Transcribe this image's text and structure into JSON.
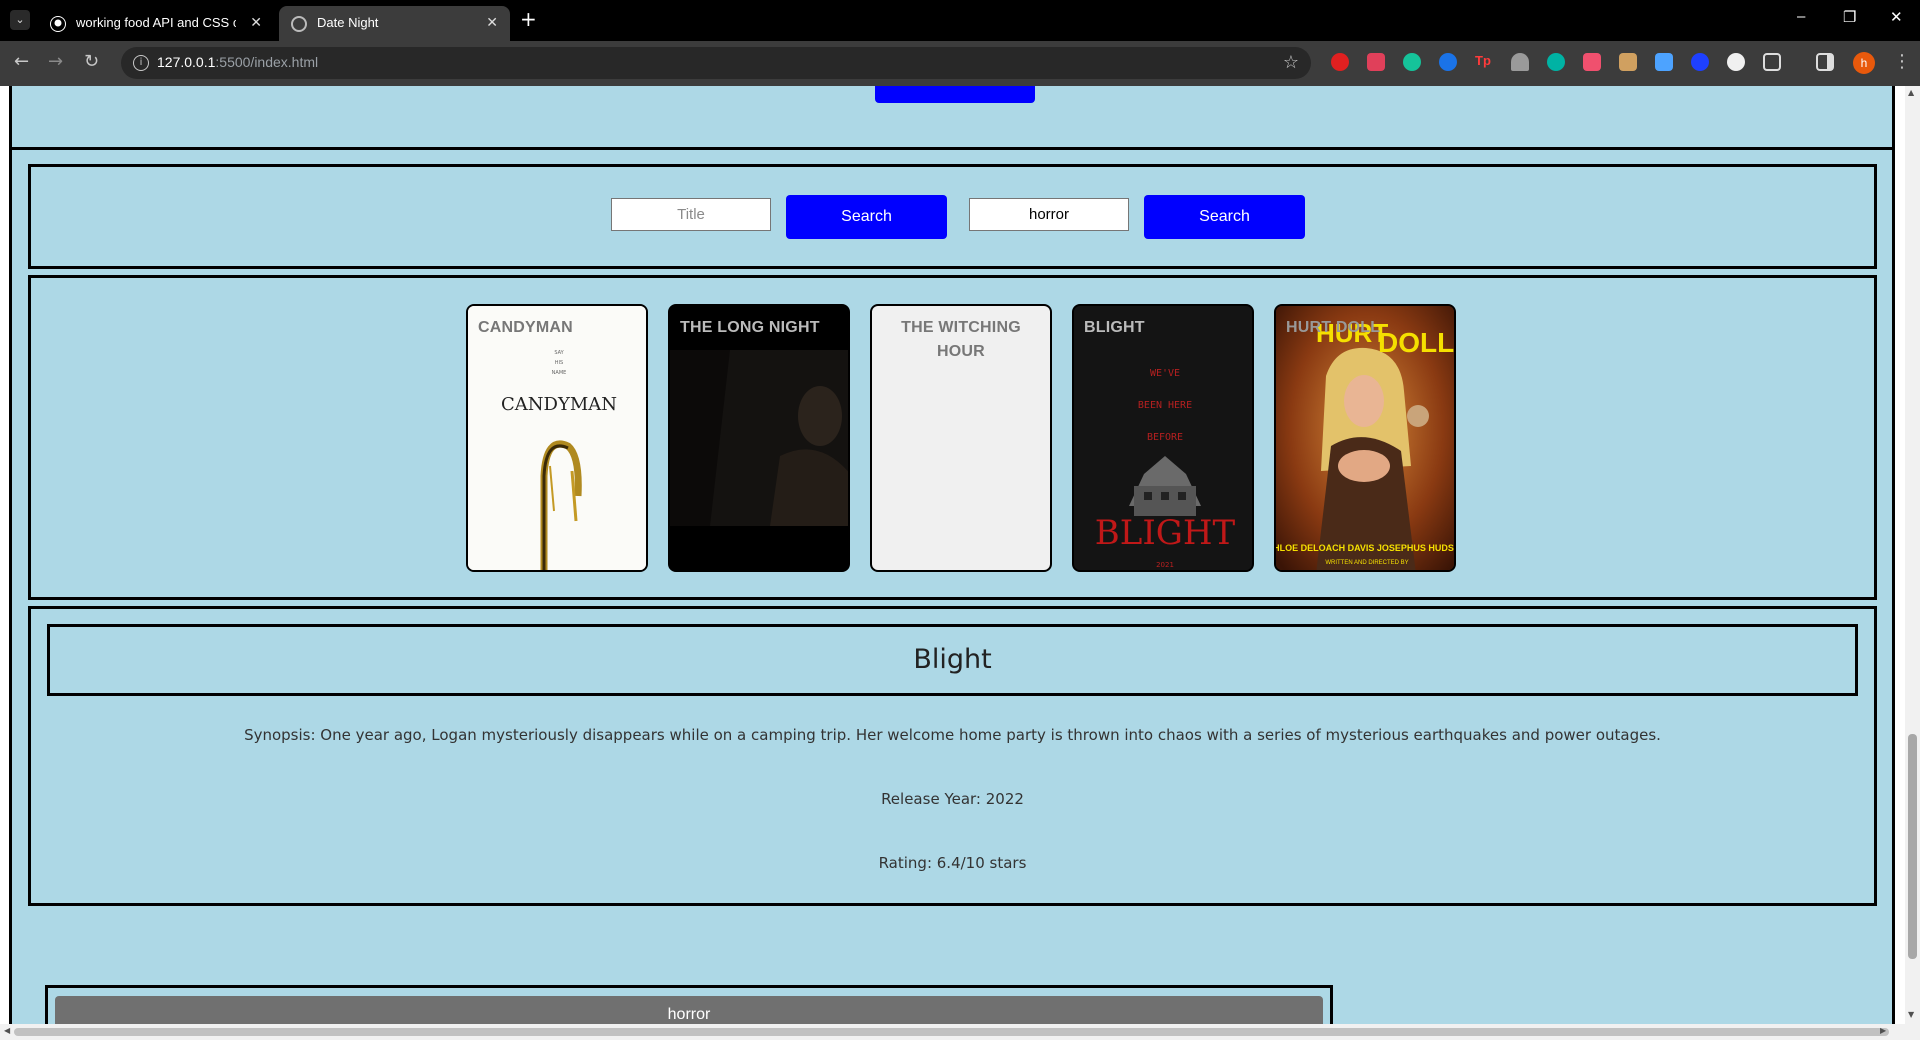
{
  "browser": {
    "tabs": [
      {
        "title": "working food API and CSS corr",
        "active": false,
        "icon": "github-icon"
      },
      {
        "title": "Date Night",
        "active": true,
        "icon": "globe-icon"
      }
    ],
    "new_tab": "+",
    "window_controls": {
      "minimize": "–",
      "restore": "❐",
      "close": "✕"
    },
    "url": {
      "host": "127.0.0.1",
      "path": ":5500/index.html"
    },
    "avatar_letter": "h",
    "extensions": [
      "red-ext-icon",
      "pocket-icon",
      "grammarly-icon",
      "blue-circle-ext-icon",
      "tp-icon",
      "gray-ext-icon",
      "teal-ext-icon",
      "red-arrow-ext-icon",
      "folder-ext-icon",
      "speaker-icon",
      "blue-ring-ext-icon",
      "white-ext-icon",
      "puzzle-icon",
      "sidepanel-icon"
    ]
  },
  "search": {
    "title_placeholder": "Title",
    "title_value": "",
    "genre_value": "horror",
    "button1_label": "Search",
    "button2_label": "Search",
    "button_color": "#0000ff"
  },
  "results": [
    {
      "title": "CANDYMAN",
      "poster": "candyman"
    },
    {
      "title": "THE LONG NIGHT",
      "poster": "long-night"
    },
    {
      "title": "THE WITCHING HOUR",
      "poster": "none"
    },
    {
      "title": "BLIGHT",
      "poster": "blight"
    },
    {
      "title": "HURT DOLL",
      "poster": "hurt-doll"
    }
  ],
  "posters": {
    "candyman": {
      "small_lines": [
        "SAY",
        "HIS",
        "NAME"
      ],
      "logo": "CANDYMAN"
    },
    "blight": {
      "tagline": [
        "WE'VE",
        "BEEN HERE",
        "BEFORE"
      ],
      "logo": "BLIGHT",
      "year": "2021"
    },
    "hurt_doll": {
      "logo_top": "HURT",
      "logo_bottom": "DOLL",
      "credits": "CHLOE DELOACH DAVIS   JOSEPHUS HUDSON",
      "credits_sub": "WRITTEN AND DIRECTED BY"
    }
  },
  "detail": {
    "title": "Blight",
    "synopsis": "Synopsis: One year ago, Logan mysteriously disappears while on a camping trip. Her welcome home party is thrown into chaos with a series of mysterious earthquakes and power outages.",
    "release": "Release Year: 2022",
    "rating": "Rating: 6.4/10 stars"
  },
  "saved": {
    "label": "horror"
  },
  "colors": {
    "page_bg": "#add8e6",
    "button": "#0000ff",
    "chrome_bg": "#3c3c3c",
    "saved_bar": "#707070"
  }
}
